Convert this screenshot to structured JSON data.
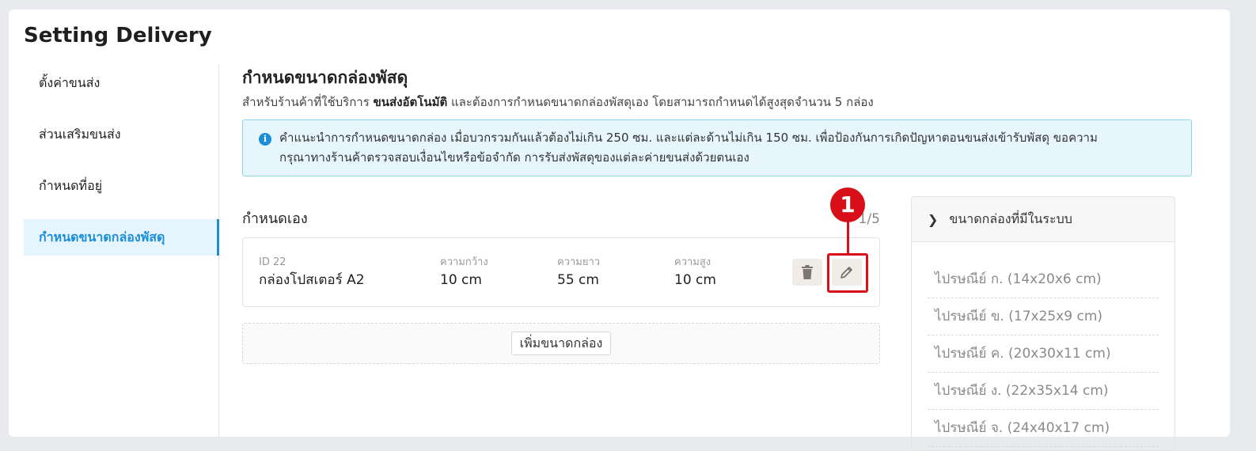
{
  "page": {
    "title": "Setting Delivery"
  },
  "sidebar": {
    "items": [
      {
        "label": "ตั้งค่าขนส่ง"
      },
      {
        "label": "ส่วนเสริมขนส่ง"
      },
      {
        "label": "กำหนดที่อยู่"
      },
      {
        "label": "กำหนดขนาดกล่องพัสดุ",
        "active": true
      }
    ]
  },
  "section": {
    "title": "กำหนดขนาดกล่องพัสดุ",
    "desc_prefix": "สำหรับร้านค้าที่ใช้บริการ ",
    "desc_bold": "ขนส่งอัตโนมัติ",
    "desc_suffix": " และต้องการกำหนดขนาดกล่องพัสดุเอง โดยสามารถกำหนดได้สูงสุดจำนวน 5 กล่อง"
  },
  "info": {
    "icon": "info-icon",
    "line1": "คำแนะนำการกำหนดขนาดกล่อง เมื่อบวกรวมกันแล้วต้องไม่เกิน 250 ซม. และแต่ละด้านไม่เกิน 150 ซม. เพื่อป้องกันการเกิดปัญหาตอนขนส่งเข้ารับพัสดุ ขอความ",
    "line2": "กรุณาทางร้านค้าตรวจสอบเงื่อนไขหรือข้อจำกัด การรับส่งพัสดุของแต่ละค่ายขนส่งด้วยตนเอง"
  },
  "custom": {
    "title": "กำหนดเอง",
    "count": "1/5",
    "box": {
      "id": "ID 22",
      "name": "กล่องโปสเตอร์ A2",
      "width_label": "ความกว้าง",
      "width": "10 cm",
      "length_label": "ความยาว",
      "length": "55 cm",
      "height_label": "ความสูง",
      "height": "10 cm"
    },
    "add_label": "เพิ่มขนาดกล่อง"
  },
  "callout": {
    "number": "1",
    "color": "#d80f19"
  },
  "presets": {
    "title": "ขนาดกล่องที่มีในระบบ",
    "items": [
      "ไปรษณีย์ ก. (14x20x6 cm)",
      "ไปรษณีย์ ข. (17x25x9 cm)",
      "ไปรษณีย์ ค. (20x30x11 cm)",
      "ไปรษณีย์ ง. (22x35x14 cm)",
      "ไปรษณีย์ จ. (24x40x17 cm)"
    ]
  },
  "colors": {
    "accent": "#1a8fd8",
    "info_bg": "#e6f6fc",
    "highlight": "#d80f19"
  }
}
